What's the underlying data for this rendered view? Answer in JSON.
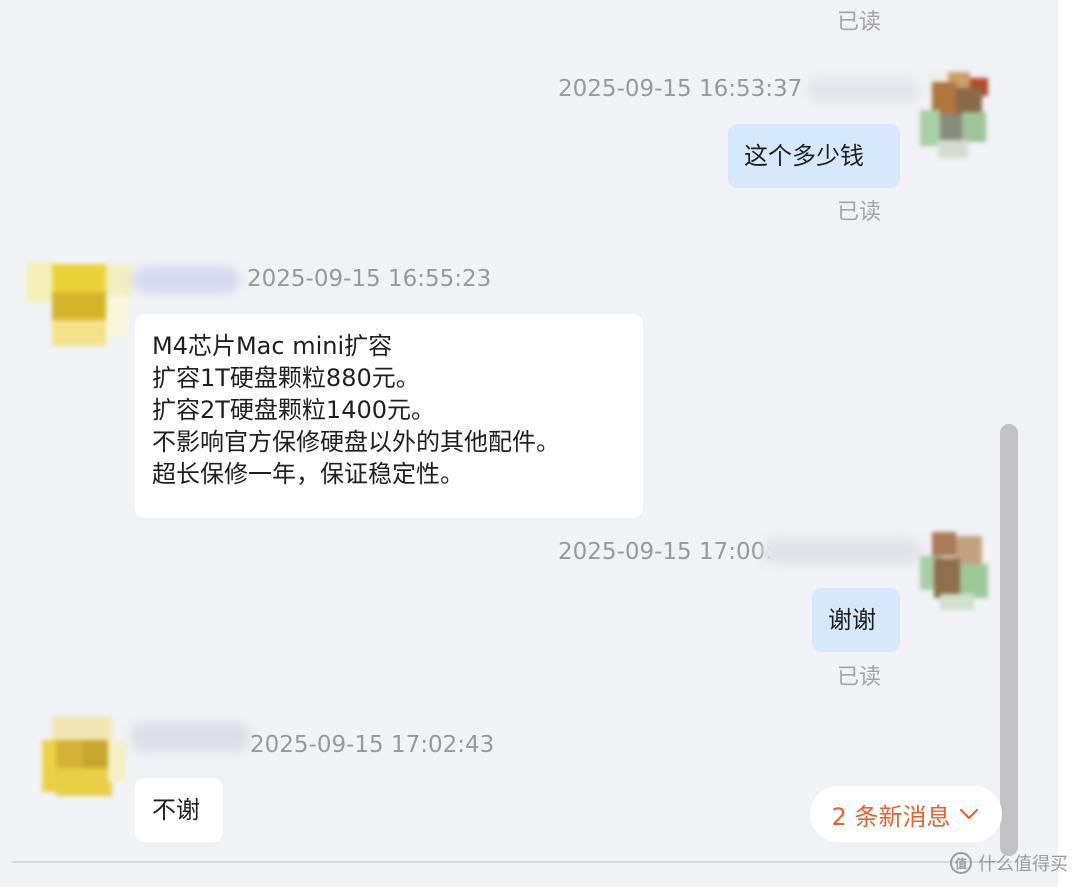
{
  "messages": [
    {
      "read_status": "已读"
    },
    {
      "timestamp": "2025-09-15 16:53:37",
      "text": "这个多少钱",
      "read_status": "已读"
    },
    {
      "timestamp": "2025-09-15 16:55:23",
      "lines": [
        "M4芯片Mac mini扩容",
        "扩容1T硬盘颗粒880元。",
        "扩容2T硬盘颗粒1400元。",
        "不影响官方保修硬盘以外的其他配件。",
        "超长保修一年，保证稳定性。"
      ]
    },
    {
      "timestamp": "2025-09-15 17:00:",
      "text": "谢谢",
      "read_status": "已读"
    },
    {
      "timestamp": "2025-09-15 17:02:43",
      "text": "不谢"
    }
  ],
  "new_messages": {
    "label": "2 条新消息",
    "icon": "chevron-down-icon"
  },
  "watermark": {
    "text": "什么值得买",
    "logo": "值"
  },
  "colors": {
    "chat_background": "#f1f2f6",
    "outgoing_bubble": "#d6e8fb",
    "incoming_bubble": "#ffffff",
    "new_message_accent": "#e8612c",
    "muted_text": "#a4a4a4"
  }
}
